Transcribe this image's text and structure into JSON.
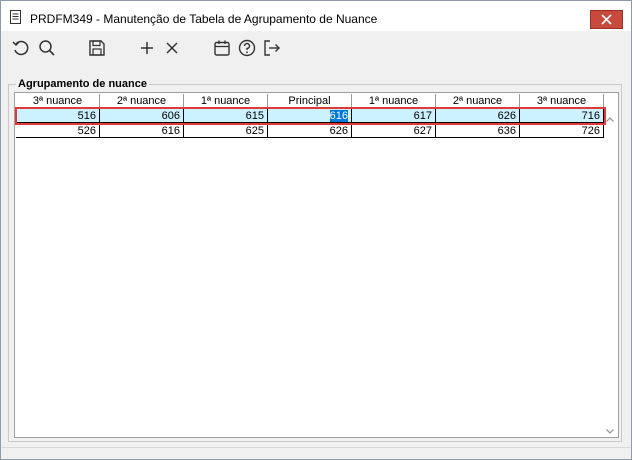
{
  "window": {
    "title": "PRDFM349 - Manutenção de Tabela de Agrupamento de Nuance"
  },
  "toolbar": {
    "icons": [
      "refresh-icon",
      "search-icon",
      "save-icon",
      "add-icon",
      "delete-icon",
      "calendar-icon",
      "help-icon",
      "exit-icon"
    ]
  },
  "group": {
    "title": "Agrupamento de nuance"
  },
  "table": {
    "columns": [
      "3ª nuance",
      "2ª nuance",
      "1ª nuance",
      "Principal",
      "1ª nuance",
      "2ª nuance",
      "3ª nuance"
    ],
    "rows": [
      [
        "516",
        "606",
        "615",
        "616",
        "617",
        "626",
        "716"
      ],
      [
        "526",
        "616",
        "625",
        "626",
        "627",
        "636",
        "726"
      ]
    ],
    "selected_row": 0,
    "active_column": 3
  },
  "colors": {
    "selection_row": "#cdf2ff",
    "selection_text_bg": "#0078d7",
    "highlight_outline": "#e03a3a",
    "close_button": "#c74a3d"
  }
}
